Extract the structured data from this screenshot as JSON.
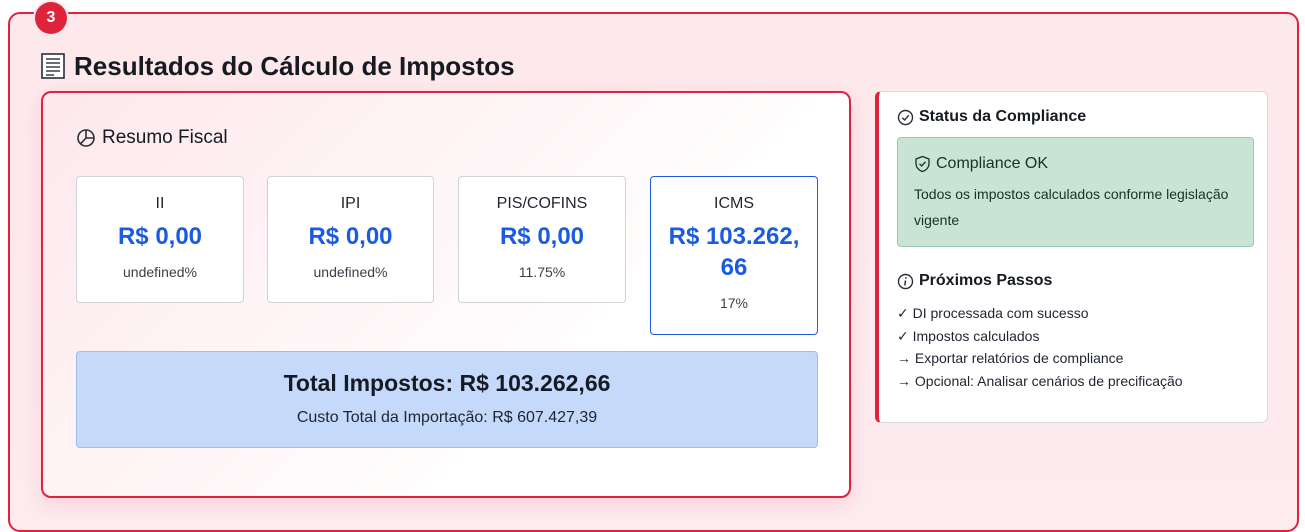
{
  "step": {
    "number": "3"
  },
  "section": {
    "title": "Resultados do Cálculo de Impostos"
  },
  "summary": {
    "title": "Resumo Fiscal",
    "taxes": [
      {
        "label": "II",
        "value": "R$ 0,00",
        "rate": "undefined%"
      },
      {
        "label": "IPI",
        "value": "R$ 0,00",
        "rate": "undefined%"
      },
      {
        "label": "PIS/COFINS",
        "value": "R$ 0,00",
        "rate": "11.75%"
      },
      {
        "label": "ICMS",
        "value": "R$ 103.262,\n66",
        "rate": "17%"
      }
    ],
    "total": "Total Impostos: R$ 103.262,66",
    "import_cost": "Custo Total da Importação: R$ 607.427,39"
  },
  "compliance": {
    "title": "Status da Compliance",
    "status_title": "Compliance OK",
    "status_text": "Todos os impostos calculados conforme legislação vigente",
    "next_title": "Próximos Passos",
    "next_steps": [
      "✓ DI processada com sucesso",
      "✓ Impostos calculados",
      "→ Exportar relatórios de compliance",
      "→ Opcional: Analisar cenários de precificação"
    ]
  },
  "colors": {
    "accent": "#e0233d",
    "value_blue": "#1a5be0",
    "success_bg": "#c9e4d3",
    "total_bg": "#c5d9fb"
  }
}
